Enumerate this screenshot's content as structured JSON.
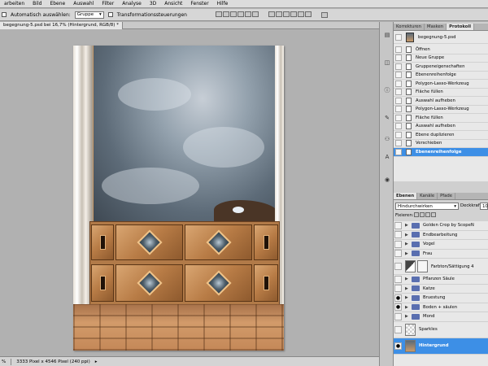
{
  "menu": [
    "arbeiten",
    "Bild",
    "Ebene",
    "Auswahl",
    "Filter",
    "Analyse",
    "3D",
    "Ansicht",
    "Fenster",
    "Hilfe"
  ],
  "options": {
    "auto_select_label": "Automatisch auswählen:",
    "auto_select_value": "Gruppe",
    "transform_label": "Transformationssteuerungen"
  },
  "document": {
    "tab_title": "begegnung-5.psd bei 16,7% (Hintergrund, RGB/8) *"
  },
  "status": {
    "zoom": "%",
    "doc_info": "3333 Pixel x 4546 Pixel (240 ppi)"
  },
  "history_panel": {
    "tabs": [
      "Korrekturen",
      "Masken",
      "Protokoll"
    ],
    "active_tab": "Protokoll",
    "snapshot_label": "begegnung-5.psd",
    "items": [
      "Öffnen",
      "Neue Gruppe",
      "Gruppeneigenschaften",
      "Ebenenreihenfolge",
      "Polygon-Lasso-Werkzeug",
      "Fläche füllen",
      "Auswahl aufheben",
      "Polygon-Lasso-Werkzeug",
      "Fläche füllen",
      "Auswahl aufheben",
      "Ebene duplizieren",
      "Verschieben",
      "Ebenenreihenfolge"
    ],
    "selected_index": 12
  },
  "layers_panel": {
    "tabs": [
      "Ebenen",
      "Kanäle",
      "Pfade"
    ],
    "active_tab": "Ebenen",
    "blend_mode": "Hindurchwirken",
    "opacity_label": "Deckkraft:",
    "opacity_value": "10",
    "lock_label": "Fixieren:",
    "layers": [
      {
        "name": "Golden Crop by ScopeN",
        "kind": "group",
        "visible": false
      },
      {
        "name": "Endbearbeitung",
        "kind": "group",
        "visible": false
      },
      {
        "name": "Vogel",
        "kind": "group",
        "visible": false
      },
      {
        "name": "Frau",
        "kind": "group",
        "visible": false
      },
      {
        "name": "Farbton/Sättigung 4",
        "kind": "adjustment",
        "visible": false
      },
      {
        "name": "Pflanzen Säule",
        "kind": "group",
        "visible": false
      },
      {
        "name": "Katze",
        "kind": "group",
        "visible": false
      },
      {
        "name": "Bruestung",
        "kind": "group",
        "visible": true
      },
      {
        "name": "Boden + säulen",
        "kind": "group",
        "visible": true
      },
      {
        "name": "Mond",
        "kind": "group",
        "visible": false
      },
      {
        "name": "Sparkles",
        "kind": "pixel",
        "visible": false
      },
      {
        "name": "Hintergrund",
        "kind": "background",
        "visible": true
      }
    ],
    "selected_index": 11
  },
  "colors": {
    "selection_blue": "#3d8fe6",
    "folder_blue": "#5a6fb0"
  }
}
